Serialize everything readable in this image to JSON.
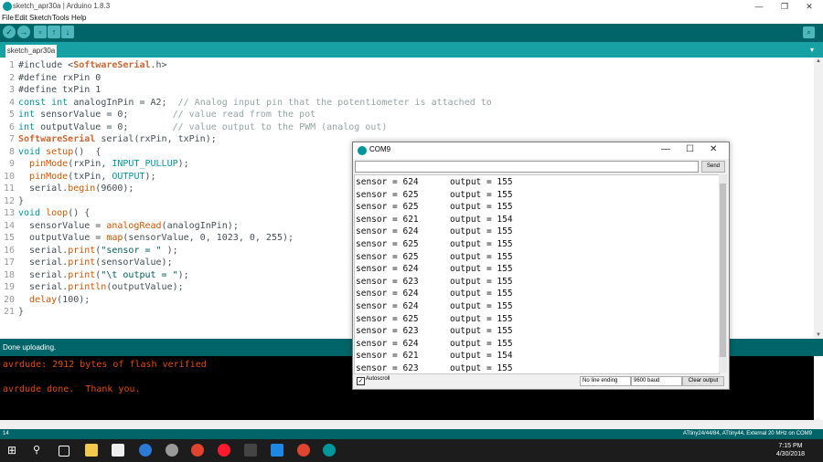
{
  "window": {
    "title": "sketch_apr30a | Arduino 1.8.3"
  },
  "menu": [
    "File",
    "Edit",
    "Sketch",
    "Tools",
    "Help"
  ],
  "toolbar": {
    "verify": "✓",
    "upload": "→",
    "new": "▫",
    "open": "↑",
    "save": "↓",
    "serial_monitor": "⌕"
  },
  "tab": {
    "label": "sketch_apr30a",
    "menu_icon": "▾"
  },
  "editor": {
    "line_numbers": [
      "1",
      "2",
      "3",
      "4",
      "5",
      "6",
      "7",
      "8",
      "9",
      "10",
      "11",
      "12",
      "13",
      "14",
      "15",
      "16",
      "17",
      "18",
      "19",
      "20",
      "21"
    ]
  },
  "status": {
    "message": "Done uploading."
  },
  "console": {
    "line1": "avrdude: 2912 bytes of flash verified",
    "line2": "avrdude done.  Thank you."
  },
  "bottom_status": {
    "line": "14",
    "board": "ATtiny24/44/84, ATtiny44, External 20 MHz on COM9"
  },
  "taskbar": {
    "time": "7:15 PM",
    "date": "4/30/2018"
  },
  "serial": {
    "title": "COM9",
    "send_label": "Send",
    "autoscroll_label": "Autoscroll",
    "autoscroll_checked": true,
    "line_ending": "No line ending",
    "baud": "9600 baud",
    "clear_label": "Clear output",
    "rows": [
      {
        "sensor": "624",
        "output": "155"
      },
      {
        "sensor": "625",
        "output": "155"
      },
      {
        "sensor": "625",
        "output": "155"
      },
      {
        "sensor": "621",
        "output": "154"
      },
      {
        "sensor": "624",
        "output": "155"
      },
      {
        "sensor": "625",
        "output": "155"
      },
      {
        "sensor": "625",
        "output": "155"
      },
      {
        "sensor": "624",
        "output": "155"
      },
      {
        "sensor": "623",
        "output": "155"
      },
      {
        "sensor": "624",
        "output": "155"
      },
      {
        "sensor": "624",
        "output": "155"
      },
      {
        "sensor": "625",
        "output": "155"
      },
      {
        "sensor": "623",
        "output": "155"
      },
      {
        "sensor": "624",
        "output": "155"
      },
      {
        "sensor": "621",
        "output": "154"
      },
      {
        "sensor": "623",
        "output": "155"
      }
    ]
  }
}
